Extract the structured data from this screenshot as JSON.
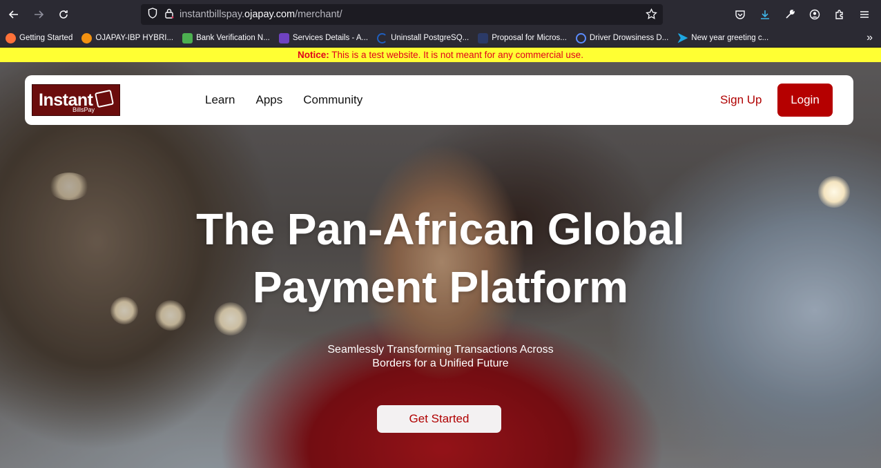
{
  "browser": {
    "url_prefix": "instantbillspay.",
    "url_domain": "ojapay.com",
    "url_path": "/merchant/",
    "bookmarks": [
      {
        "label": "Getting Started",
        "color": "#ff7139"
      },
      {
        "label": "OJAPAY-IBP HYBRI...",
        "color": "#f29111"
      },
      {
        "label": "Bank Verification N...",
        "color": "#4caf50"
      },
      {
        "label": "Services Details - A...",
        "color": "#6f42c1"
      },
      {
        "label": "Uninstall PostgreSQ...",
        "color": "#1f5fbf"
      },
      {
        "label": "Proposal for Micros...",
        "color": "#2b3a67"
      },
      {
        "label": "Driver Drowsiness D...",
        "color": "#5b8cff"
      },
      {
        "label": "New year greeting c...",
        "color": "#1ea7e1"
      }
    ]
  },
  "notice": {
    "label": "Notice:",
    "text": " This is a test website. It is not meant for any commercial use."
  },
  "nav": {
    "logo_main": "Instant",
    "logo_sub": "BillsPay",
    "menu": [
      "Learn",
      "Apps",
      "Community"
    ],
    "signup": "Sign Up",
    "login": "Login"
  },
  "hero": {
    "line1": "The Pan-African Global",
    "line2": "Payment Platform",
    "sub1": "Seamlessly Transforming Transactions Across",
    "sub2": "Borders for a Unified Future",
    "cta": "Get Started"
  }
}
